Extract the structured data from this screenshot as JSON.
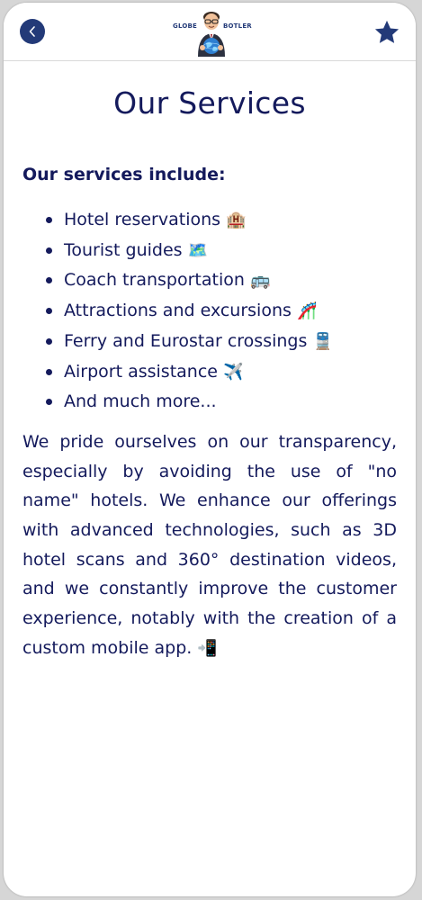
{
  "header": {
    "logo_left_text": "GLOBE",
    "logo_right_text": "BOTLER",
    "back_icon": "chevron-left-icon",
    "favorite_icon": "star-icon"
  },
  "main": {
    "title": "Our Services",
    "subtitle": "Our services include:",
    "services": [
      {
        "label": "Hotel reservations",
        "emoji": "🏨"
      },
      {
        "label": "Tourist guides",
        "emoji": "🗺️"
      },
      {
        "label": "Coach transportation",
        "emoji": "🚌"
      },
      {
        "label": "Attractions and excursions",
        "emoji": "🎢"
      },
      {
        "label": "Ferry and Eurostar crossings",
        "emoji": "🚆"
      },
      {
        "label": "Airport assistance",
        "emoji": "✈️"
      },
      {
        "label": "And much more...",
        "emoji": ""
      }
    ],
    "description": "We pride ourselves on our transparency, especially by avoiding the use of \"no name\" hotels. We enhance our offerings with advanced technologies, such as 3D hotel scans and 360° destination videos, and we constantly improve the customer experience, notably with the creation of a custom mobile app.",
    "description_emoji": "📲"
  },
  "colors": {
    "brand_navy": "#233a78",
    "text_navy": "#141a5c",
    "background": "#ffffff"
  }
}
